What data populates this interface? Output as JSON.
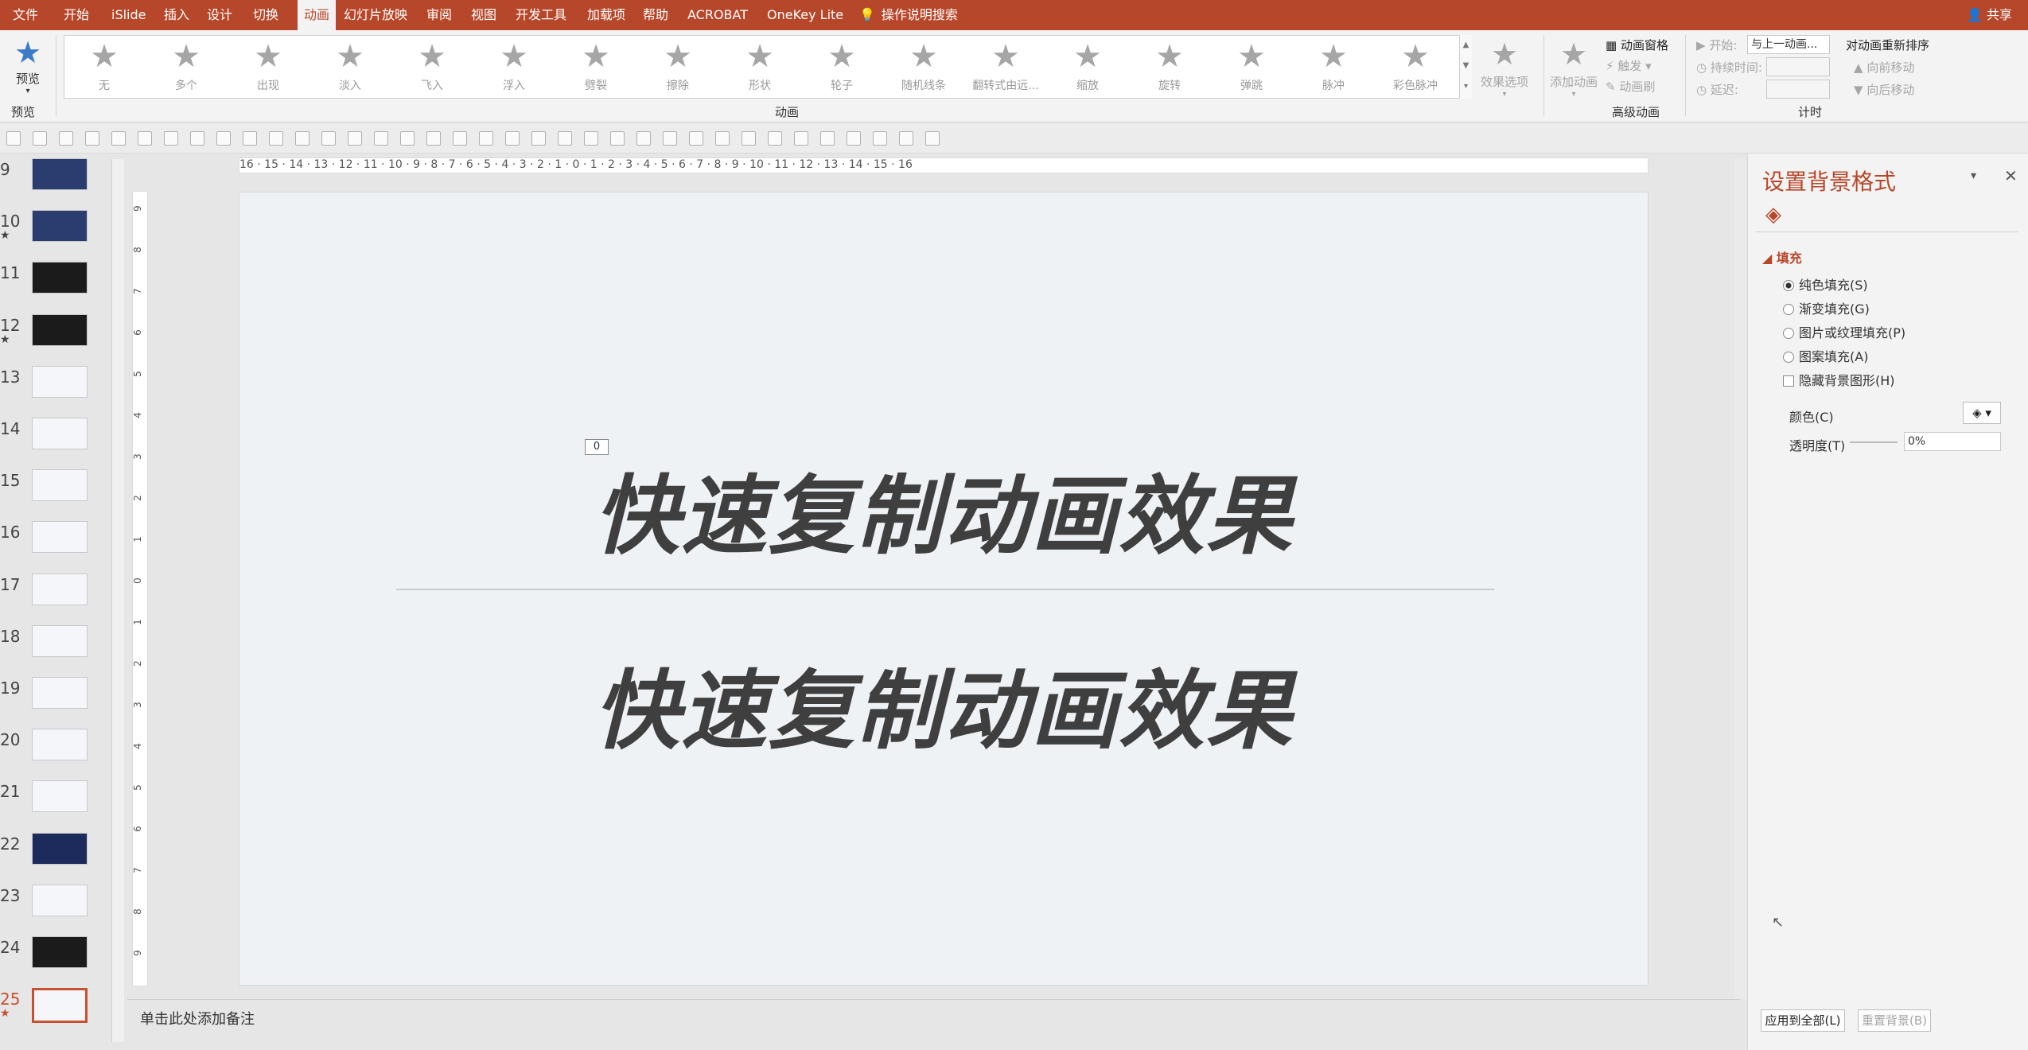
{
  "ribbon_tabs": [
    "文件",
    "开始",
    "iSlide",
    "插入",
    "设计",
    "切换",
    "动画",
    "幻灯片放映",
    "审阅",
    "视图",
    "开发工具",
    "加载项",
    "帮助",
    "ACROBAT",
    "OneKey Lite"
  ],
  "active_tab": "动画",
  "search": {
    "label": "操作说明搜索"
  },
  "share": {
    "label": "共享"
  },
  "preview": {
    "label": "预览",
    "group": "预览"
  },
  "animations": {
    "group": "动画",
    "items": [
      "无",
      "多个",
      "出现",
      "淡入",
      "飞入",
      "浮入",
      "劈裂",
      "擦除",
      "形状",
      "轮子",
      "随机线条",
      "翻转式由远...",
      "缩放",
      "旋转",
      "弹跳",
      "脉冲",
      "彩色脉冲"
    ],
    "effect_options": "效果选项"
  },
  "advanced": {
    "group": "高级动画",
    "add": "添加动画",
    "pane": "动画窗格",
    "trigger": "触发",
    "painter": "动画刷"
  },
  "timing": {
    "group": "计时",
    "start_label": "开始:",
    "start_value": "与上一动画...",
    "duration_label": "持续时间:",
    "delay_label": "延迟:",
    "reorder": "对动画重新排序",
    "forward": "向前移动",
    "backward": "向后移动"
  },
  "thumbnails": [
    {
      "num": "9",
      "star": false,
      "style": "blue"
    },
    {
      "num": "10",
      "star": true,
      "style": "blue"
    },
    {
      "num": "11",
      "star": false,
      "style": "dark"
    },
    {
      "num": "12",
      "star": true,
      "style": "dark"
    },
    {
      "num": "13",
      "star": false,
      "style": "light"
    },
    {
      "num": "14",
      "star": false,
      "style": "light"
    },
    {
      "num": "15",
      "star": false,
      "style": "light"
    },
    {
      "num": "16",
      "star": false,
      "style": "light"
    },
    {
      "num": "17",
      "star": false,
      "style": "light"
    },
    {
      "num": "18",
      "star": false,
      "style": "light"
    },
    {
      "num": "19",
      "star": false,
      "style": "light"
    },
    {
      "num": "20",
      "star": false,
      "style": "light"
    },
    {
      "num": "21",
      "star": false,
      "style": "light"
    },
    {
      "num": "22",
      "star": false,
      "style": "navy"
    },
    {
      "num": "23",
      "star": false,
      "style": "light"
    },
    {
      "num": "24",
      "star": false,
      "style": "dark"
    },
    {
      "num": "25",
      "star": true,
      "style": "light"
    }
  ],
  "selected_slide": "25",
  "ruler": {
    "horizontal": "16 · 15 · 14 · 13 · 12 · 11 · 10 · 9 · 8 · 7 · 6 · 5 · 4 · 3 · 2 · 1 · 0 · 1 · 2 · 3 · 4 · 5 · 6 · 7 · 8 · 9 · 10 · 11 · 12 · 13 · 14 · 15 · 16"
  },
  "slide": {
    "anim_tag": "0",
    "title1": "快速复制动画效果",
    "title2": "快速复制动画效果"
  },
  "notes": {
    "placeholder": "单击此处添加备注"
  },
  "format_pane": {
    "title": "设置背景格式",
    "section": "填充",
    "options": [
      "纯色填充(S)",
      "渐变填充(G)",
      "图片或纹理填充(P)",
      "图案填充(A)"
    ],
    "selected": "纯色填充(S)",
    "hide_bg": "隐藏背景图形(H)",
    "color_label": "颜色(C)",
    "transparency_label": "透明度(T)",
    "transparency_value": "0%",
    "apply_all": "应用到全部(L)",
    "reset": "重置背景(B)"
  }
}
